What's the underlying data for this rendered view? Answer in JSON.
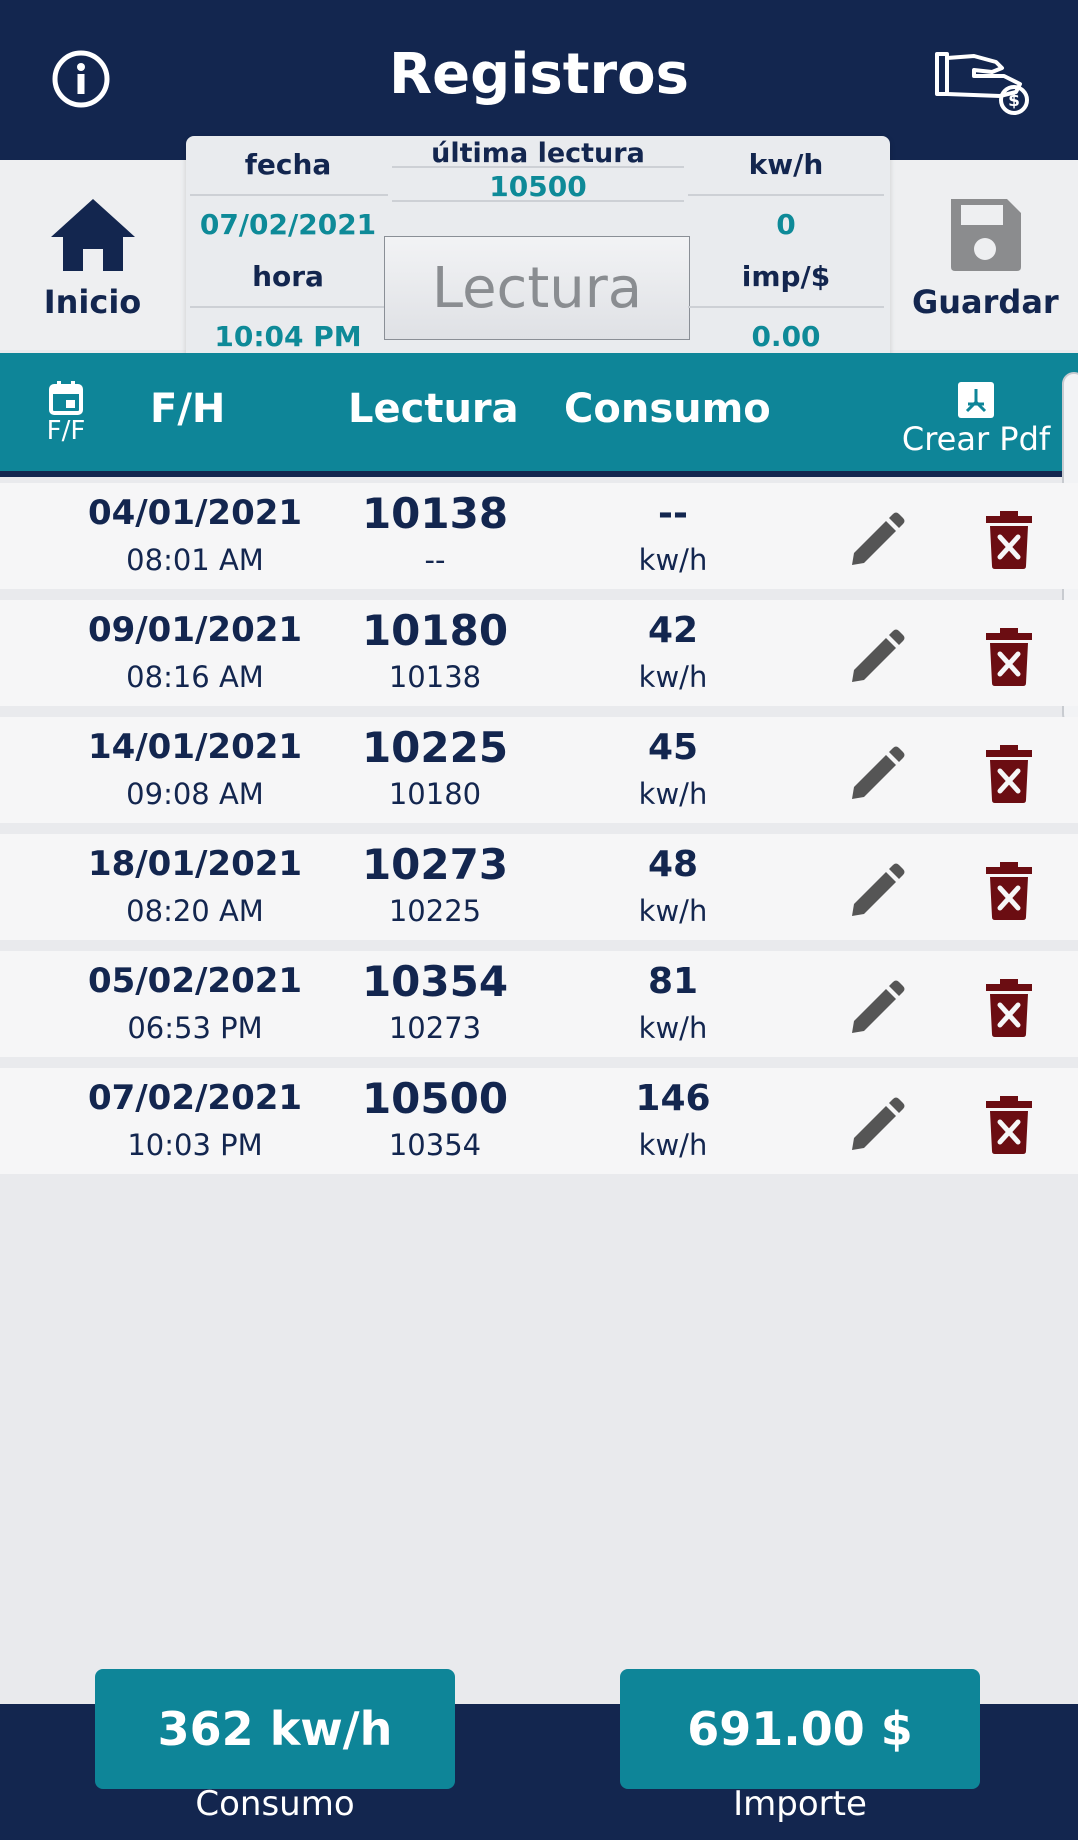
{
  "header": {
    "title": "Registros"
  },
  "nav": {
    "home_label": "Inicio",
    "save_label": "Guardar"
  },
  "summary": {
    "fecha_label": "fecha",
    "fecha_value": "07/02/2021",
    "hora_label": "hora",
    "hora_value": "10:04 PM",
    "ultima_label": "última lectura",
    "ultima_value": "10500",
    "kwh_label": "kw/h",
    "kwh_value": "0",
    "imp_label": "imp/$",
    "imp_value": "0.00",
    "lectura_placeholder": "Lectura"
  },
  "table": {
    "filter_label": "F/F",
    "col_fh": "F/H",
    "col_lectura": "Lectura",
    "col_consumo": "Consumo",
    "pdf_label": "Crear Pdf",
    "rows": [
      {
        "date": "04/01/2021",
        "time": "08:01 AM",
        "reading": "10138",
        "previous": "--",
        "consumption": "--",
        "unit": "kw/h"
      },
      {
        "date": "09/01/2021",
        "time": "08:16 AM",
        "reading": "10180",
        "previous": "10138",
        "consumption": "42",
        "unit": "kw/h"
      },
      {
        "date": "14/01/2021",
        "time": "09:08 AM",
        "reading": "10225",
        "previous": "10180",
        "consumption": "45",
        "unit": "kw/h"
      },
      {
        "date": "18/01/2021",
        "time": "08:20 AM",
        "reading": "10273",
        "previous": "10225",
        "consumption": "48",
        "unit": "kw/h"
      },
      {
        "date": "05/02/2021",
        "time": "06:53 PM",
        "reading": "10354",
        "previous": "10273",
        "consumption": "81",
        "unit": "kw/h"
      },
      {
        "date": "07/02/2021",
        "time": "10:03 PM",
        "reading": "10500",
        "previous": "10354",
        "consumption": "146",
        "unit": "kw/h"
      }
    ]
  },
  "footer": {
    "consumo_value": "362 kw/h",
    "consumo_label": "Consumo",
    "importe_value": "691.00 $",
    "importe_label": "Importe"
  },
  "colors": {
    "navy": "#13264f",
    "teal": "#0e8598",
    "value_teal": "#0e8a98",
    "delete_red": "#6b0d12",
    "edit_gray": "#555555"
  },
  "icons": [
    "info-icon",
    "pay-icon",
    "home-icon",
    "save-icon",
    "calendar-icon",
    "pdf-icon",
    "edit-icon",
    "delete-icon"
  ]
}
